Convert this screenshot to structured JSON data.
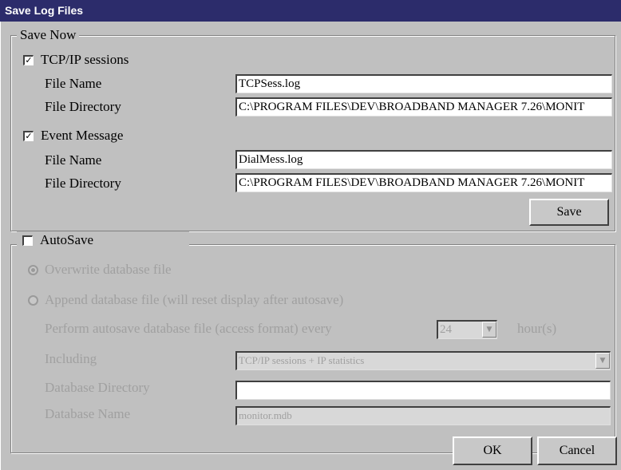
{
  "window": {
    "title": "Save Log Files"
  },
  "save_now": {
    "legend": "Save Now",
    "tcpip": {
      "label": "TCP/IP sessions",
      "checked": true,
      "file_name_label": "File Name",
      "file_name": "TCPSess.log",
      "file_directory_label": "File Directory",
      "file_directory": "C:\\PROGRAM FILES\\DEV\\BROADBAND MANAGER 7.26\\MONIT"
    },
    "event": {
      "label": "Event Message",
      "checked": true,
      "file_name_label": "File Name",
      "file_name": "DialMess.log",
      "file_directory_label": "File Directory",
      "file_directory": "C:\\PROGRAM FILES\\DEV\\BROADBAND MANAGER 7.26\\MONIT"
    },
    "save_button": "Save"
  },
  "autosave": {
    "label": "AutoSave",
    "checked": false,
    "overwrite_label": "Overwrite database file",
    "append_label": "Append database file (will reset display after autosave)",
    "perform_label": "Perform autosave database file (access format) every",
    "interval_value": "24",
    "interval_unit": "hour(s)",
    "including_label": "Including",
    "including_value": "TCP/IP sessions + IP statistics",
    "db_directory_label": "Database Directory",
    "db_directory_value": "",
    "db_name_label": "Database Name",
    "db_name_value": "monitor.mdb"
  },
  "footer": {
    "ok": "OK",
    "cancel": "Cancel"
  },
  "icons": {
    "check": "✓",
    "dropdown_arrow": "▼"
  }
}
